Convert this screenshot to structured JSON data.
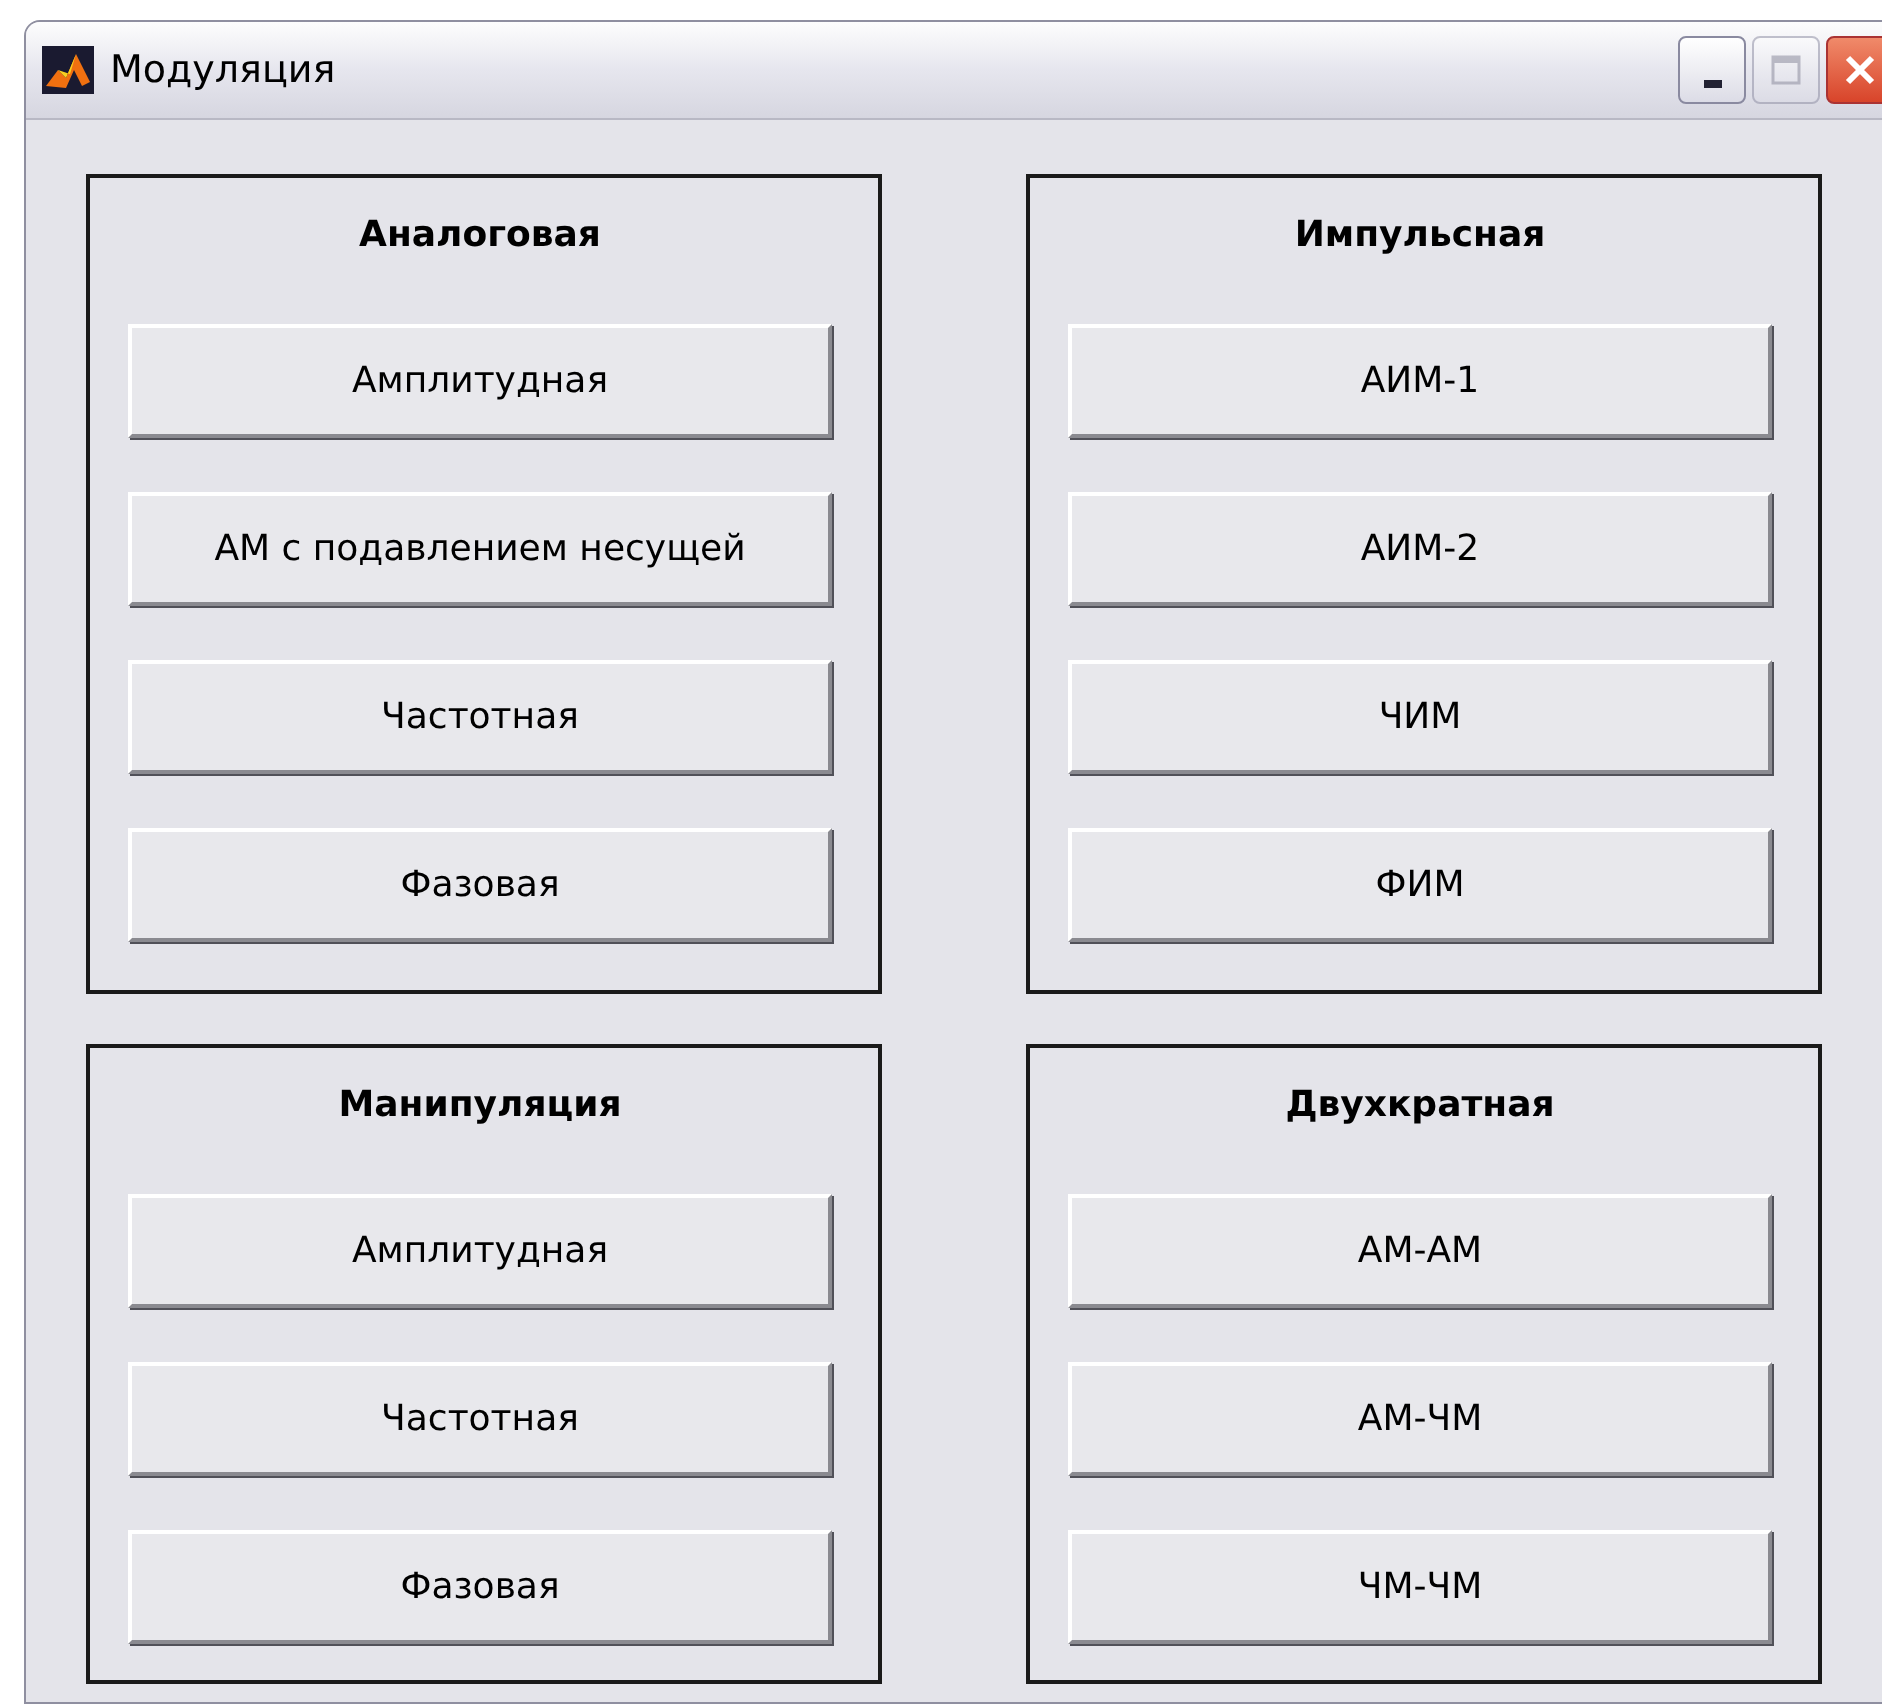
{
  "window": {
    "title": "Модуляция",
    "controls": [
      {
        "kind": "minimize",
        "disabled": false
      },
      {
        "kind": "maximize",
        "disabled": true
      },
      {
        "kind": "close",
        "disabled": false
      }
    ]
  },
  "panels": [
    {
      "title": "Аналоговая",
      "buttons": [
        "Амплитудная",
        "АМ с подавлением несущей",
        "Частотная",
        "Фазовая"
      ]
    },
    {
      "title": "Импульсная",
      "buttons": [
        "АИМ-1",
        "АИМ-2",
        "ЧИМ",
        "ФИМ"
      ]
    },
    {
      "title": "Манипуляция",
      "buttons": [
        "Амплитудная",
        "Частотная",
        "Фазовая"
      ]
    },
    {
      "title": "Двухкратная",
      "buttons": [
        "АМ-АМ",
        "АМ-ЧМ",
        "ЧМ-ЧМ"
      ]
    }
  ]
}
